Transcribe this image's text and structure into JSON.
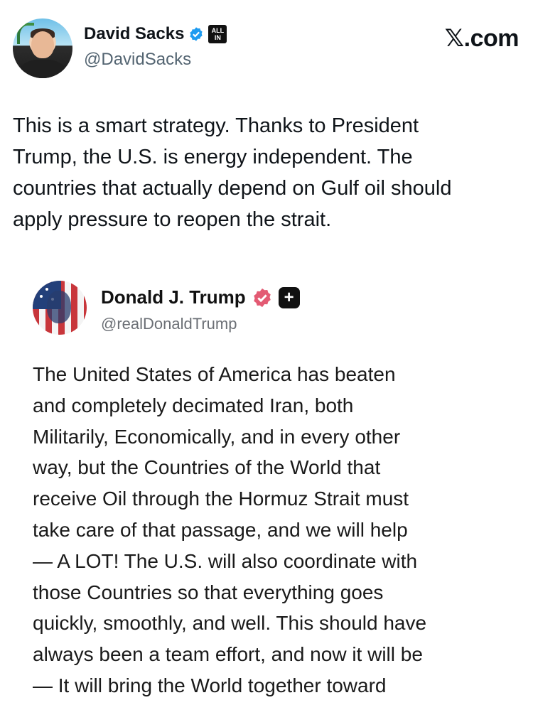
{
  "author": {
    "name": "David Sacks",
    "handle": "@DavidSacks",
    "badge_text": "ALL IN",
    "verified_color": "#1d9bf0"
  },
  "site": "𝕏.com",
  "tweet": {
    "lines": [
      "This is a smart strategy. Thanks to President",
      "Trump, the U.S. is energy independent. The",
      "countries that actually depend on Gulf oil should",
      "apply pressure to reopen the strait."
    ]
  },
  "quoted": {
    "name": "Donald J. Trump",
    "handle": "@realDonaldTrump",
    "verified_color": "#e35a73",
    "plus_icon": "plus-icon",
    "lines": [
      "The United States of America has beaten",
      "and completely decimated Iran, both",
      "Militarily, Economically, and in every other",
      "way, but the Countries of the World that",
      "receive Oil through the Hormuz Strait must",
      "take care of that passage, and we will help",
      "— A LOT! The U.S. will also coordinate with",
      "those Countries so that everything goes",
      "quickly, smoothly, and well. This should have",
      "always been a team effort, and now it will be",
      "— It will bring the World together toward"
    ]
  }
}
